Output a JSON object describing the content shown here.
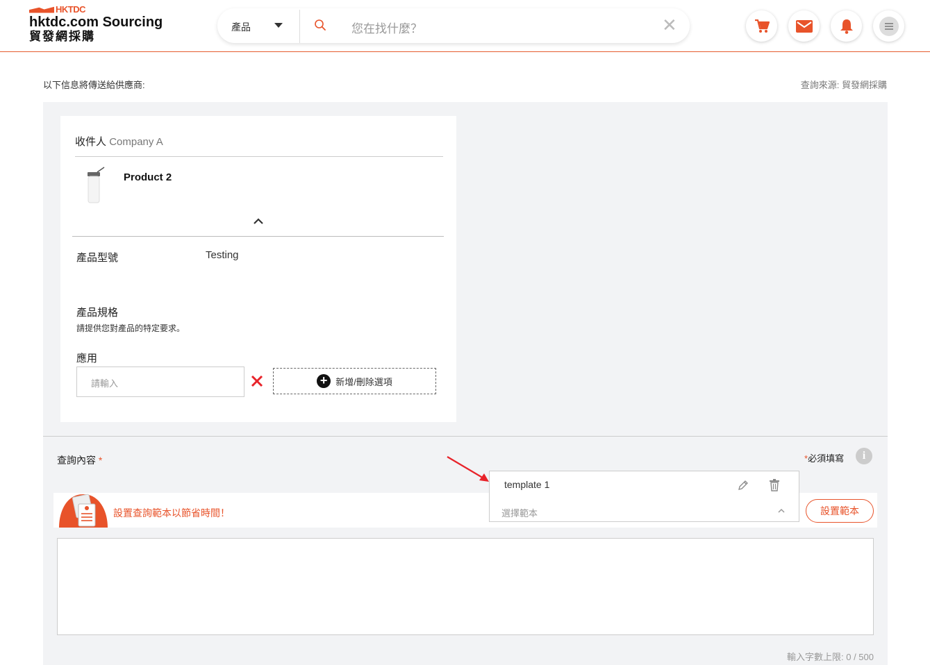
{
  "header": {
    "logo_brand": "HKTDC",
    "logo_title": "hktdc.com Sourcing",
    "logo_sub": "貿發網採購",
    "search_category": "產品",
    "search_placeholder": "您在找什麼？",
    "clear_symbol": "✕",
    "icons": [
      "cart-icon",
      "mail-icon",
      "bell-icon",
      "menu-icon"
    ],
    "accent_color": "#e8532a"
  },
  "page": {
    "info_line": "以下信息將傳送給供應商:",
    "source_line": "查詢來源: 貿發網採購"
  },
  "card": {
    "recipient_label": "收件人",
    "recipient_company": "Company A",
    "product_name": "Product 2",
    "model_label": "產品型號",
    "model_value": "Testing",
    "spec_label": "產品規格",
    "spec_hint": "請提供您對產品的特定要求。",
    "app_label": "應用",
    "app_placeholder": "請輸入",
    "add_option_label": "新增/刪除選項",
    "plus_symbol": "+"
  },
  "query": {
    "label": "查詢內容",
    "star": "*",
    "required_note": "必須填寫",
    "info_symbol": "i",
    "template_promo": "設置查詢範本以節省時間！",
    "template_item": "template 1",
    "select_template": "選擇範本",
    "set_template_button": "設置範本",
    "counter": "輸入字數上限: 0 / 500"
  }
}
